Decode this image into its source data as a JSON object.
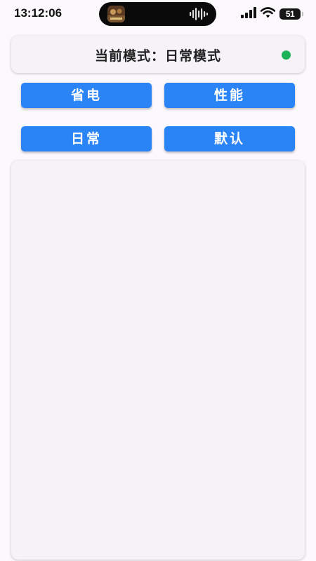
{
  "status_bar": {
    "time": "13:12:06",
    "battery_level": "51",
    "icons": [
      "app-thumbnail-icon",
      "audio-waveform-icon",
      "signal-icon",
      "wifi-icon",
      "battery-icon"
    ]
  },
  "mode_card": {
    "current_mode_text": "当前模式：日常模式",
    "status_color": "#1db257"
  },
  "buttons": {
    "power_save": "省电",
    "performance": "性能",
    "daily": "日常",
    "default": "默认"
  },
  "colors": {
    "accent": "#2a84f5",
    "background": "#fcf9fd"
  }
}
